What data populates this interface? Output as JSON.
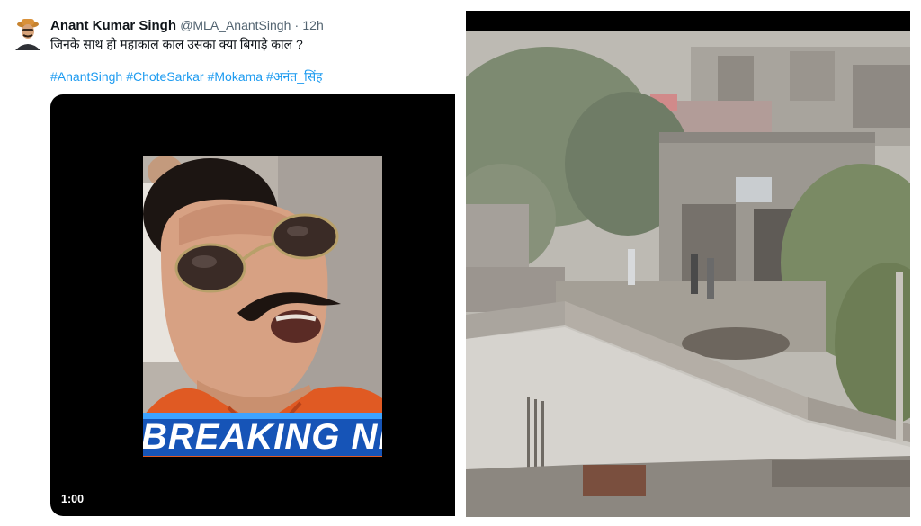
{
  "tweet": {
    "author_name": "Anant Kumar Singh",
    "handle": "@MLA_AnantSingh",
    "separator": "·",
    "time": "12h",
    "text": "जिनके साथ हो महाकाल काल उसका क्या बिगाड़े काल ?",
    "hashtags": [
      "#AnantSingh",
      "#ChoteSarkar",
      "#Mokama",
      "#अनंत_सिंह"
    ],
    "video": {
      "duration": "1:00",
      "overlay_text": "BREAKING NE"
    }
  },
  "colors": {
    "link": "#1d9bf0",
    "secondary_text": "#536471",
    "breaking_banner": "#1654b7"
  }
}
